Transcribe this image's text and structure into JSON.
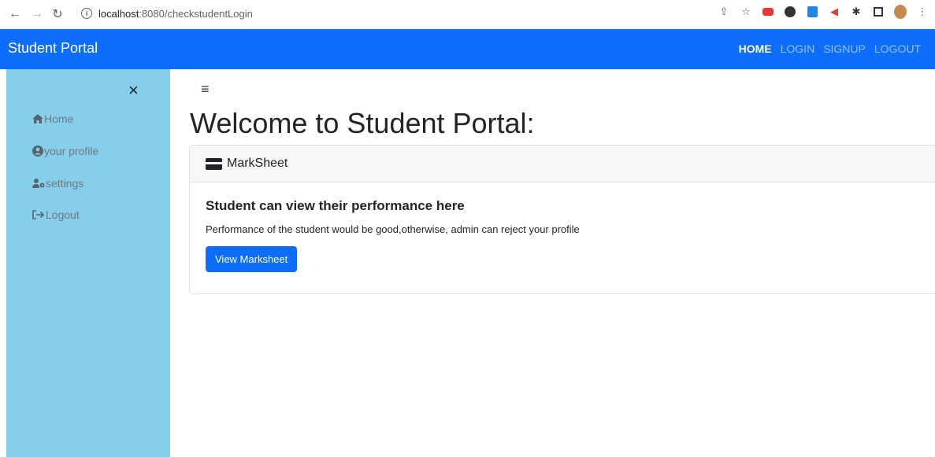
{
  "browser": {
    "url_host": "localhost",
    "url_path": ":8080/checkstudentLogin"
  },
  "navbar": {
    "brand": "Student Portal",
    "links": [
      {
        "label": "HOME",
        "active": true
      },
      {
        "label": "LOGIN",
        "active": false
      },
      {
        "label": "SIGNUP",
        "active": false
      },
      {
        "label": "LOGOUT",
        "active": false
      }
    ]
  },
  "sidebar": {
    "close_glyph": "×",
    "items": [
      {
        "label": "Home",
        "icon": "home-icon"
      },
      {
        "label": "your profile",
        "icon": "user-circle-icon"
      },
      {
        "label": "settings",
        "icon": "user-cog-icon"
      },
      {
        "label": "Logout",
        "icon": "sign-out-icon"
      }
    ]
  },
  "main": {
    "menu_glyph": "≡",
    "title": "Welcome to Student Portal:",
    "card": {
      "header": "MarkSheet",
      "title": "Student can view their performance here",
      "text": "Performance of the student would be good,otherwise, admin can reject your profile",
      "button": "View Marksheet"
    }
  },
  "colors": {
    "navbar": "#0d6efd",
    "sidebar": "#87ceeb",
    "button": "#0d6efd"
  }
}
